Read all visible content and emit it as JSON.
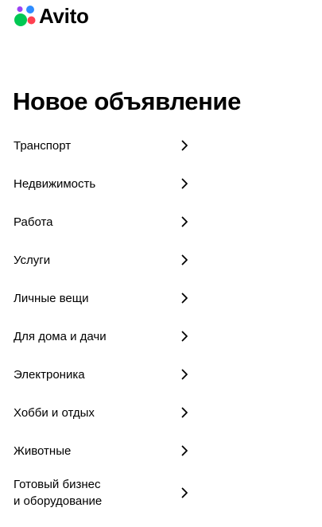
{
  "header": {
    "logo_text": "Avito",
    "logo_colors": {
      "green": "#00c853",
      "blue": "#2e8cff",
      "purple": "#9b41f5",
      "red": "#ff4050"
    }
  },
  "main": {
    "title": "Новое объявление",
    "categories": [
      {
        "label": "Транспорт",
        "icon": "chevron-right-icon"
      },
      {
        "label": "Недвижимость",
        "icon": "chevron-right-icon"
      },
      {
        "label": "Работа",
        "icon": "chevron-right-icon"
      },
      {
        "label": "Услуги",
        "icon": "chevron-right-icon"
      },
      {
        "label": "Личные вещи",
        "icon": "chevron-right-icon"
      },
      {
        "label": "Для дома и дачи",
        "icon": "chevron-right-icon"
      },
      {
        "label": "Электроника",
        "icon": "chevron-right-icon"
      },
      {
        "label": "Хобби и отдых",
        "icon": "chevron-right-icon"
      },
      {
        "label": "Животные",
        "icon": "chevron-right-icon"
      },
      {
        "label": "Готовый бизнес\nи оборудование",
        "icon": "chevron-right-icon"
      }
    ]
  }
}
